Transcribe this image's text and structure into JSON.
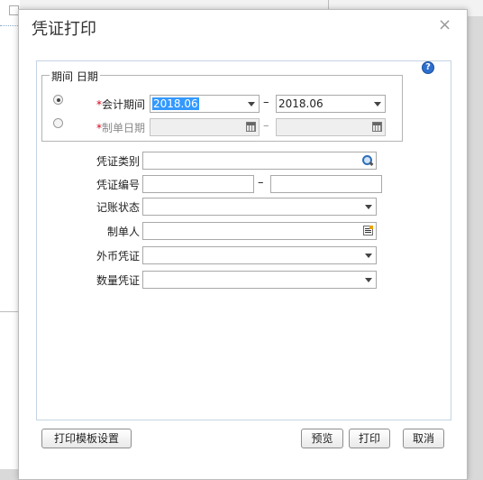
{
  "dialog": {
    "title": "凭证打印",
    "close_glyph": "×",
    "help_glyph": "?"
  },
  "period_group": {
    "legend": "期间 日期",
    "accounting_period": {
      "label": "会计期间",
      "required_mark": "*",
      "selected": true,
      "from": "2018.06",
      "to": "2018.06",
      "separator": "–"
    },
    "voucher_date": {
      "label": "制单日期",
      "required_mark": "*",
      "selected": false,
      "from": "",
      "to": "",
      "separator": "–"
    }
  },
  "fields": {
    "voucher_type": {
      "label": "凭证类别",
      "value": ""
    },
    "voucher_number": {
      "label": "凭证编号",
      "from": "",
      "to": "",
      "separator": "–"
    },
    "posting_status": {
      "label": "记账状态",
      "value": ""
    },
    "preparer": {
      "label": "制单人",
      "value": ""
    },
    "foreign_currency_voucher": {
      "label": "外币凭证",
      "value": ""
    },
    "quantity_voucher": {
      "label": "数量凭证",
      "value": ""
    }
  },
  "buttons": {
    "template_settings": "打印模板设置",
    "preview": "预览",
    "print": "打印",
    "cancel": "取消"
  },
  "icons": {
    "help": "help-icon",
    "close": "close-icon",
    "calendar": "calendar-icon",
    "search": "search-icon",
    "list": "list-icon",
    "dropdown": "chevron-down-icon"
  },
  "colors": {
    "required": "#d0021b",
    "selection": "#3399ff",
    "help": "#2d6fcf",
    "panel_border": "#c3d3e3"
  }
}
